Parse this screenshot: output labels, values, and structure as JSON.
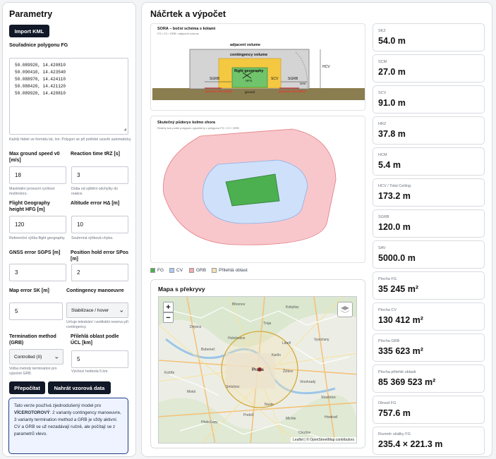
{
  "left": {
    "title": "Parametry",
    "import_button": "Import KML",
    "polygon_label": "Souřadnice polygonu FG",
    "polygon_lines": [
      "50.089920, 14.420810",
      "50.090410, 14.423540",
      "50.088970, 14.424110",
      "50.088420, 14.421120",
      "50.089920, 14.420810"
    ],
    "polygon_hint": "Každý řádek ve formátu lat, lon. Polygon se při potřebě uzavře automaticky.",
    "v0_label": "Max ground speed v0 [m/s]",
    "v0_value": "18",
    "v0_hint": "Maximální provozní rychlost multirotoru.",
    "trz_label": "Reaction time tRZ [s]",
    "trz_value": "3",
    "trz_hint": "Doba od zjištění odchylky do reakce.",
    "hfg_label": "Flight Geography height HFG [m]",
    "hfg_value": "120",
    "hfg_hint": "Referenční výška flight geography.",
    "ha_label": "Altitude error HΔ [m]",
    "ha_value": "10",
    "ha_hint": "Souhrnná výšková chyba.",
    "sgps_label": "GNSS error SGPS [m]",
    "sgps_value": "3",
    "spos_label": "Position hold error SPos [m]",
    "spos_value": "2",
    "sk_label": "Map error SK [m]",
    "sk_value": "5",
    "cm_label": "Contingency manoeuvre",
    "cm_value": "Stabilizace / hover",
    "cm_hint": "Určuje teleskání i vertikální rezervu při contingency.",
    "term_label": "Termination method (GRB)",
    "term_value": "Controlled (II)",
    "term_hint": "Volba metody termination pro výpočet GRB.",
    "adj_label": "Přilehlá oblast podle ÚCL [km]",
    "adj_value": "5",
    "adj_hint": "Výchozí hodnota 5 km.",
    "recalc_button": "Přepočítat",
    "sample_button": "Nahrát vzorová data",
    "info_pre": "Tato verze používá zjednodušený model pro ",
    "info_bold": "VÍCEROTOROVÝ",
    "info_post": ": 2 varianty contingency manoeuvre, 3 varianty termination method a GRB je vždy aktivní. CV a GRB se už nezadávají ručně, ale počítají se z parametrů vlevo."
  },
  "right": {
    "title": "Náčrtek a výpočet",
    "side": {
      "title": "SORA – boční schéma s kótami",
      "subtitle": "FG / CV / GRB / adjacent volume",
      "adjacent": "adjacent volume",
      "contingency": "contingency volume",
      "fg": "flight geography",
      "hfg": "HFG",
      "hcv": "HCV",
      "sgrb": "SGRB",
      "scv": "SCV",
      "sav": "SAV",
      "ground": "ground",
      "grb": "ground risk buffer"
    },
    "top": {
      "title": "Skutečný půdorys kolmo shora",
      "subtitle": "Reálný tvar podle polygonu vypočtený z polygonu FG / CV / GRB"
    },
    "legend": [
      "FG",
      "CV",
      "GRB",
      "Přilehlá oblast"
    ],
    "map": {
      "title": "Mapa s překryvy",
      "zoom_in": "+",
      "zoom_out": "−",
      "attribution": "Leaflet | © OpenStreetMap contributors",
      "places": [
        "Dejvice",
        "Holešovice",
        "Karlín",
        "Libeň",
        "Vysočany",
        "Žižkov",
        "Vinohrady",
        "Smíchov",
        "Praha",
        "Motol",
        "Michle",
        "Nusle",
        "Hostivař",
        "Strašnice",
        "Troja",
        "Bubeneč",
        "Břevnov",
        "Košíře",
        "Kobylisy",
        "Chodov",
        "Podolí",
        "Hlubočepy"
      ]
    },
    "results": [
      {
        "label": "SKZ",
        "value": "54.0 m"
      },
      {
        "label": "SCM",
        "value": "27.0 m"
      },
      {
        "label": "SCV",
        "value": "91.0 m"
      },
      {
        "label": "HRZ",
        "value": "37.8 m"
      },
      {
        "label": "HCM",
        "value": "5.4 m"
      },
      {
        "label": "HCV / Total Ceiling",
        "value": "173.2 m"
      },
      {
        "label": "SGRB",
        "value": "120.0 m"
      },
      {
        "label": "SAV",
        "value": "5000.0 m"
      },
      {
        "label": "Plocha FG",
        "value": "35 245 m²"
      },
      {
        "label": "Plocha CV",
        "value": "130 412 m²"
      },
      {
        "label": "Plocha GRB",
        "value": "335 623 m²"
      },
      {
        "label": "Plocha přilehlé oblasti",
        "value": "85 369 523 m²"
      },
      {
        "label": "Obvod FG",
        "value": "757.6 m"
      },
      {
        "label": "Rozměr obálky FG",
        "value": "235.4 × 221.3 m"
      }
    ]
  },
  "colors": {
    "fg": "#4caf50",
    "cv": "#aecbf5",
    "grb": "#f6a9ae",
    "adj": "#f3e3b3",
    "dark": "#111827",
    "info_bg": "#eef3ff",
    "info_border": "#1d3a8a"
  }
}
